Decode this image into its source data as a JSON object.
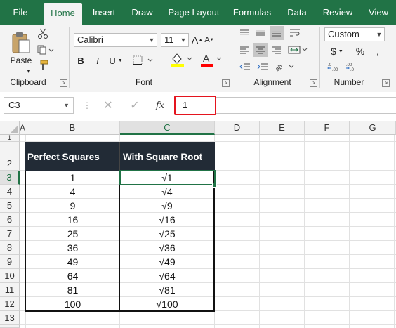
{
  "ribbon": {
    "tabs": [
      "File",
      "Home",
      "Insert",
      "Draw",
      "Page Layout",
      "Formulas",
      "Data",
      "Review",
      "View"
    ],
    "active_tab": "Home",
    "clipboard": {
      "paste_label": "Paste",
      "group_label": "Clipboard"
    },
    "font": {
      "name": "Calibri",
      "size": "11",
      "bold": "B",
      "italic": "I",
      "underline": "U",
      "grow": "A",
      "shrink": "A",
      "group_label": "Font"
    },
    "alignment": {
      "group_label": "Alignment"
    },
    "number": {
      "format": "Custom",
      "currency": "$",
      "percent": "%",
      "group_label": "Number"
    },
    "colors": {
      "accent": "#217346",
      "font_color": "#ff0000",
      "fill_color": "#ffff00",
      "header_fill": "#222b36"
    }
  },
  "formula_bar": {
    "name_box": "C3",
    "fx": "fx",
    "value": "1"
  },
  "sheet": {
    "columns": [
      "A",
      "B",
      "C",
      "D",
      "E",
      "F",
      "G"
    ],
    "rows": [
      "1",
      "2",
      "3",
      "4",
      "5",
      "6",
      "7",
      "8",
      "9",
      "10",
      "11",
      "12",
      "13"
    ],
    "active_cell": "C3",
    "table": {
      "headers": [
        "Perfect Squares",
        "With Square Root"
      ],
      "rows": [
        [
          "1",
          "√1"
        ],
        [
          "4",
          "√4"
        ],
        [
          "9",
          "√9"
        ],
        [
          "16",
          "√16"
        ],
        [
          "25",
          "√25"
        ],
        [
          "36",
          "√36"
        ],
        [
          "49",
          "√49"
        ],
        [
          "64",
          "√64"
        ],
        [
          "81",
          "√81"
        ],
        [
          "100",
          "√100"
        ]
      ]
    }
  }
}
